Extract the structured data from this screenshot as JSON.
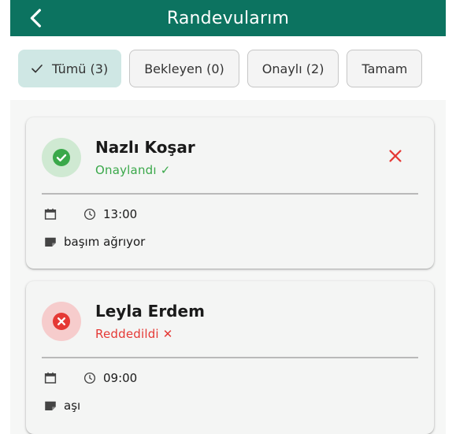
{
  "colors": {
    "primary": "#0c7360",
    "approved": "#3aa84a",
    "rejected": "#e53935"
  },
  "header": {
    "title": "Randevularım",
    "back_icon": "chevron-left-icon"
  },
  "filters": [
    {
      "label": "Tümü (3)",
      "active": true
    },
    {
      "label": "Bekleyen (0)",
      "active": false
    },
    {
      "label": "Onaylı (2)",
      "active": false
    },
    {
      "label": "Tamam",
      "active": false
    }
  ],
  "appointments": [
    {
      "name": "Nazlı Koşar",
      "status": "Onaylandı ✓",
      "date": "",
      "time": "13:00",
      "note": "başım ağrıyor"
    },
    {
      "name": "Leyla Erdem",
      "status": "Reddedildi ✕",
      "date": "",
      "time": "09:00",
      "note": "aşı"
    }
  ]
}
